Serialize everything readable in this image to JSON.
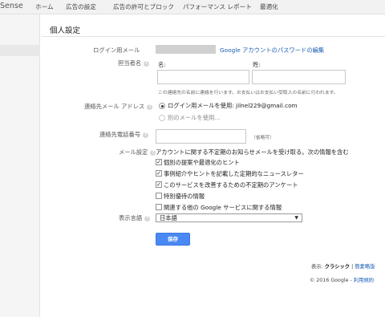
{
  "topnav": {
    "brand": "Sense",
    "items": [
      "ホーム",
      "広告の設定",
      "広告の許可とブロック",
      "パフォーマンス レポート",
      "最適化"
    ]
  },
  "page": {
    "title": "個人設定"
  },
  "login_email": {
    "label": "ログイン用メール",
    "link": "Google アカウントのパスワードの編集"
  },
  "contact_name": {
    "label": "担当者名",
    "first_label": "名:",
    "last_label": "姓:",
    "note": "この連絡先の名前に連絡を行います。お支払いはお支払い受取人の名前に行われます。",
    "first_value": "",
    "last_value": ""
  },
  "contact_email": {
    "label": "連絡先メール アドレス",
    "option1": "ログイン用メールを使用: jilnel229@gmail.com",
    "option2": "別のメールを使用..."
  },
  "phone": {
    "label": "連絡先電話番号",
    "hint": "（省略可）",
    "value": ""
  },
  "email_prefs": {
    "label": "メール設定",
    "intro": "アカウントに関する不定期のお知らせメールを受け取る。次の情報を含む",
    "items": [
      {
        "label": "個別の提案や最適化のヒント",
        "checked": true
      },
      {
        "label": "事例紹介やヒントを記載した定期的なニュースレター",
        "checked": true
      },
      {
        "label": "このサービスを改善するための不定期のアンケート",
        "checked": true
      },
      {
        "label": "特別優待の情報",
        "checked": false
      },
      {
        "label": "関連する他の Google サービスに関する情報",
        "checked": false
      }
    ]
  },
  "language": {
    "label": "表示言語",
    "value": "日本語"
  },
  "actions": {
    "save": "保存"
  },
  "footer": {
    "display_prefix": "表示: ",
    "classic": "クラシック",
    "sep": " | ",
    "compact": "簡素略版",
    "copyright": "© 2016 Google - ",
    "terms": "利用規約"
  }
}
